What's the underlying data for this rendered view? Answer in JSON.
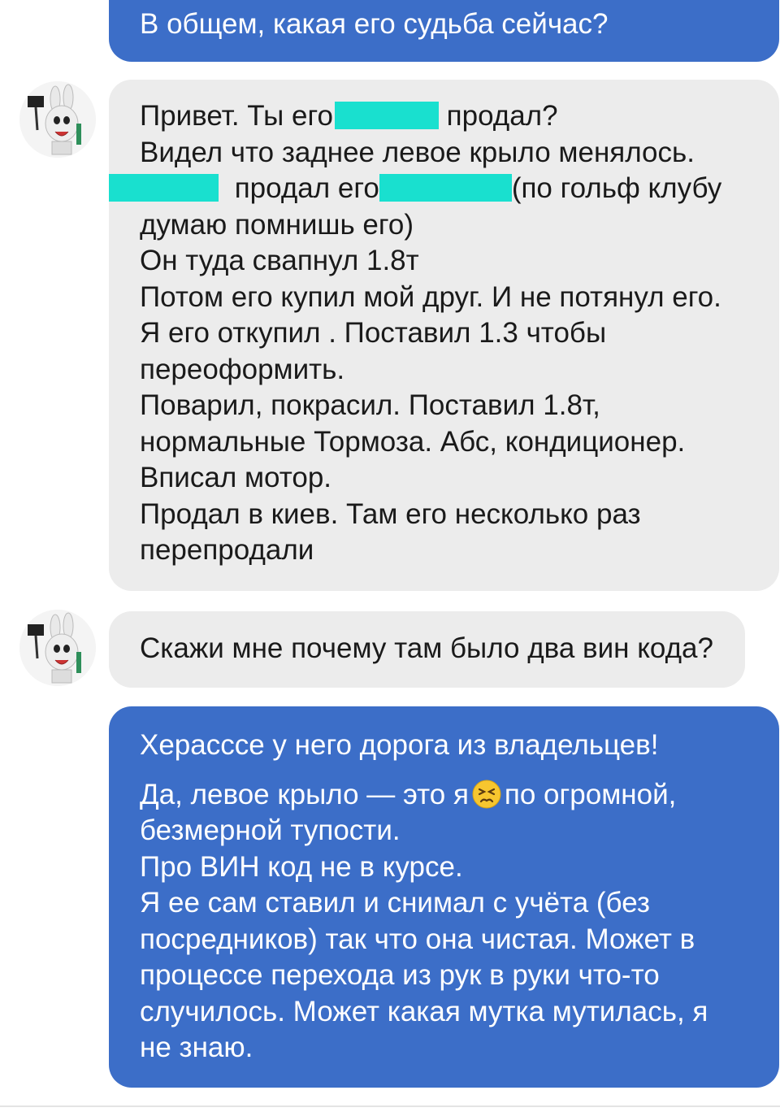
{
  "colors": {
    "outgoing_bubble": "#3c6ec8",
    "incoming_bubble": "#ececec",
    "redaction": "#19e0cf"
  },
  "messages": [
    {
      "direction": "outgoing",
      "lines": [
        "В общем, какая его судьба сейчас?"
      ]
    },
    {
      "direction": "incoming",
      "avatar_icon": "rabbid-avatar-icon",
      "line1_pre": "Привет. Ты его",
      "line1_post": "продал?",
      "line2": "Видел что заднее левое крыло менялось.",
      "line3_mid": "продал его",
      "line3_post": "(по гольф клубу",
      "lines_rest": [
        "думаю помнишь его)",
        "Он туда свапнул 1.8т",
        "Потом его купил мой друг. И не потянул его.",
        "Я его откупил . Поставил 1.3 чтобы",
        "переоформить.",
        "Поварил, покрасил. Поставил 1.8т,",
        "нормальные Тормоза. Абс, кондиционер.",
        "Вписал мотор.",
        "Продал в киев. Там его несколько раз",
        "перепродали"
      ]
    },
    {
      "direction": "incoming",
      "avatar_icon": "rabbid-avatar-icon",
      "lines": [
        "Скажи мне почему там было два вин кода?"
      ]
    },
    {
      "direction": "outgoing",
      "line_first": "Херасссе у него дорога из владельцев!",
      "line_emoji_pre": "Да, левое крыло — это я",
      "emoji_icon": "persevering-face-emoji-icon",
      "line_emoji_post": "по огромной,",
      "lines_rest": [
        "безмерной тупости.",
        "Про ВИН код не в курсе.",
        "Я ее сам ставил и снимал с учёта (без",
        "посредников) так что она чистая. Может в",
        "процессе перехода из рук в руки что-то",
        "случилось. Может какая мутка мутилась, я",
        "не знаю."
      ]
    }
  ]
}
